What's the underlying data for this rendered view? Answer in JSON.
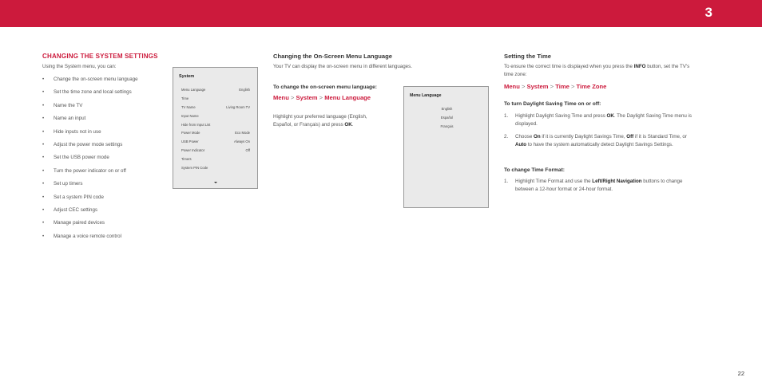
{
  "header": {
    "chapter": "3"
  },
  "system_section": {
    "title": "CHANGING THE SYSTEM SETTINGS",
    "intro": "Using the System menu, you can:",
    "bullet_symbol": "•",
    "bullets": [
      "Change the on-screen menu language",
      "Set the time zone and local settings",
      "Name the TV",
      "Name an input",
      "Hide inputs not in use",
      "Adjust the power mode settings",
      "Set the USB power mode",
      "Turn the power indicator on or off",
      "Set up timers",
      "Set a system PIN code",
      "Adjust CEC settings",
      "Manage paired devices",
      "Manage a voice remote control"
    ]
  },
  "system_menu": {
    "title": "System",
    "rows": [
      {
        "label": "Menu Language",
        "value": "English"
      },
      {
        "label": "Time",
        "value": ""
      },
      {
        "label": "TV Name",
        "value": "Living Room TV"
      },
      {
        "label": "Input Name",
        "value": ""
      },
      {
        "label": "Hide from Input List",
        "value": ""
      },
      {
        "label": "Power Mode",
        "value": "Eco Mode"
      },
      {
        "label": "USB Power",
        "value": "Always On"
      },
      {
        "label": "Power Indicator",
        "value": "Off"
      },
      {
        "label": "Timers",
        "value": ""
      },
      {
        "label": "System PIN Code",
        "value": ""
      }
    ]
  },
  "language_section": {
    "title": "Changing the On-Screen Menu Language",
    "intro": "Your TV can display the on-screen menu in different languages.",
    "sub_heading": "To change the on-screen menu language:",
    "nav": {
      "menu": "Menu",
      "sep": ">",
      "system": "System",
      "target": "Menu Language"
    },
    "instr_pre": "Highlight your preferred language (English,",
    "instr_line2_pre": "Español, or Français) and press ",
    "instr_bold": "OK",
    "instr_post": "."
  },
  "language_menu": {
    "title": "Menu Language",
    "options": [
      "English",
      "Español",
      "Français"
    ]
  },
  "time_section": {
    "title": "Setting the Time",
    "intro_pre": "To ensure the correct time is displayed when you press the ",
    "intro_bold": "INFO",
    "intro_post": " button, set the TV's",
    "intro_line2": "time zone:",
    "nav": {
      "menu": "Menu",
      "sep": ">",
      "system": "System",
      "time": "Time",
      "target": "Time Zone"
    },
    "dst_heading": "To turn Daylight Saving Time on or off:",
    "step1_num": "1.",
    "step1_pre": "Highlight Daylight Saving Time and press ",
    "step1_bold": "OK",
    "step1_post": ". The Daylight Saving Time menu is",
    "step1_line2": "displayed.",
    "step2_num": "2.",
    "step2_a": "Choose ",
    "step2_on": "On",
    "step2_b": " if it is currently Daylight Savings Time, ",
    "step2_off": "Off",
    "step2_c": " if it is Standard Time, or",
    "step2_auto": "Auto",
    "step2_d": " to have the system automatically detect Daylight Savings Settings.",
    "format_heading": "To change Time Format:",
    "fmt_num": "1.",
    "fmt_pre": "Highlight Time Format and use the ",
    "fmt_bold": "Left/Right Navigation",
    "fmt_post": " buttons to change",
    "fmt_line2": "between a 12-hour format or 24-hour format."
  },
  "footer": {
    "page_number": "22"
  }
}
